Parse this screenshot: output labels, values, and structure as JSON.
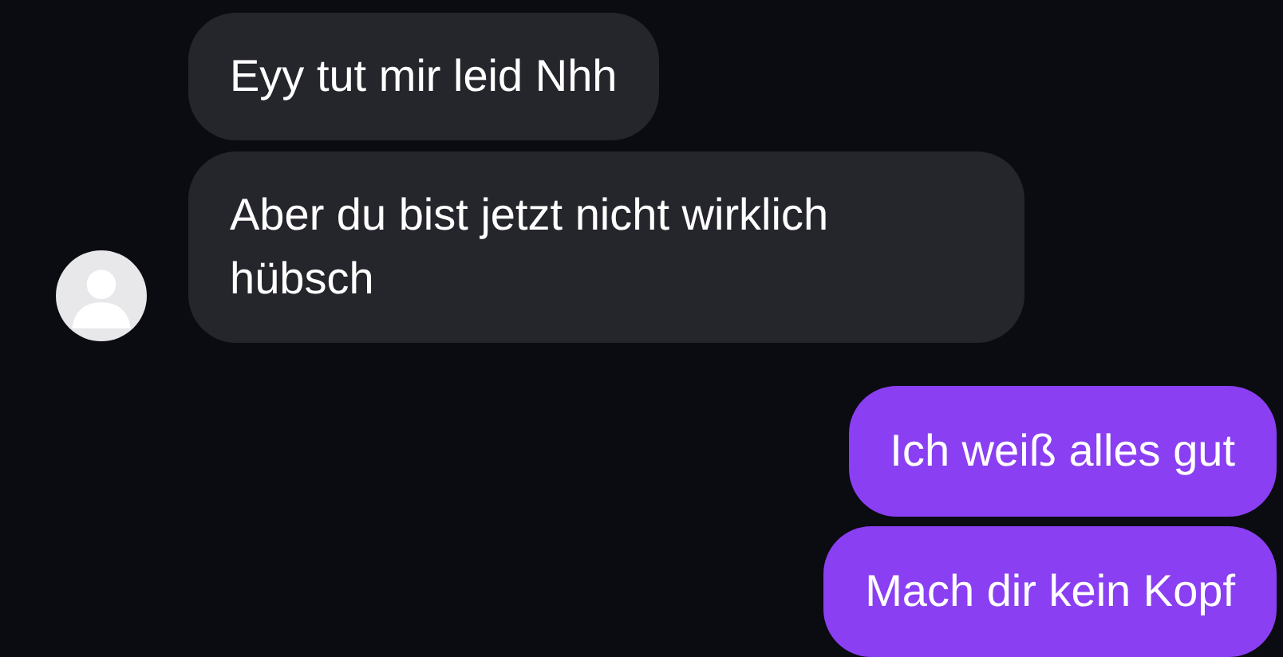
{
  "messages": [
    {
      "kind": "incoming",
      "text": "Eyy tut mir leid Nhh"
    },
    {
      "kind": "incoming",
      "text": "Aber du bist jetzt nicht wirklich hübsch"
    },
    {
      "kind": "outgoing",
      "text": "Ich weiß alles gut"
    },
    {
      "kind": "outgoing",
      "text": "Mach dir kein Kopf"
    }
  ]
}
